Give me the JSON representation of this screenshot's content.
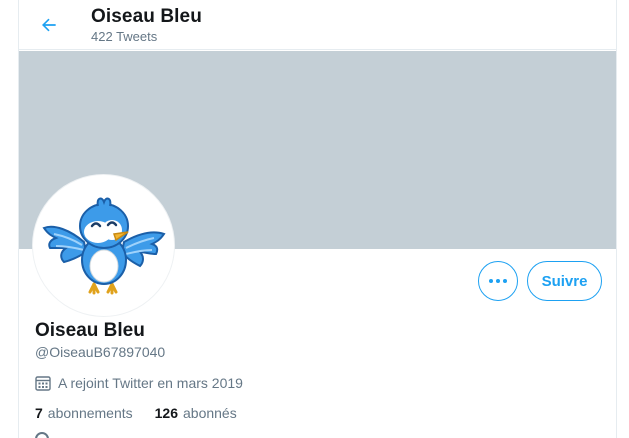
{
  "header": {
    "title": "Oiseau Bleu",
    "tweet_count": "422 Tweets",
    "back_icon": "arrow-left-icon"
  },
  "colors": {
    "accent": "#1da1f2",
    "banner": "#c4cfd6",
    "secondary_text": "#657786"
  },
  "profile": {
    "name": "Oiseau Bleu",
    "handle": "@OiseauB67897040",
    "joined": "A rejoint Twitter en mars 2019",
    "avatar_icon": "blue-bird-mascot-icon"
  },
  "actions": {
    "more_icon": "more-dots-icon",
    "follow_label": "Suivre"
  },
  "stats": {
    "following_count": "7",
    "following_label": "abonnements",
    "followers_count": "126",
    "followers_label": "abonnés"
  }
}
